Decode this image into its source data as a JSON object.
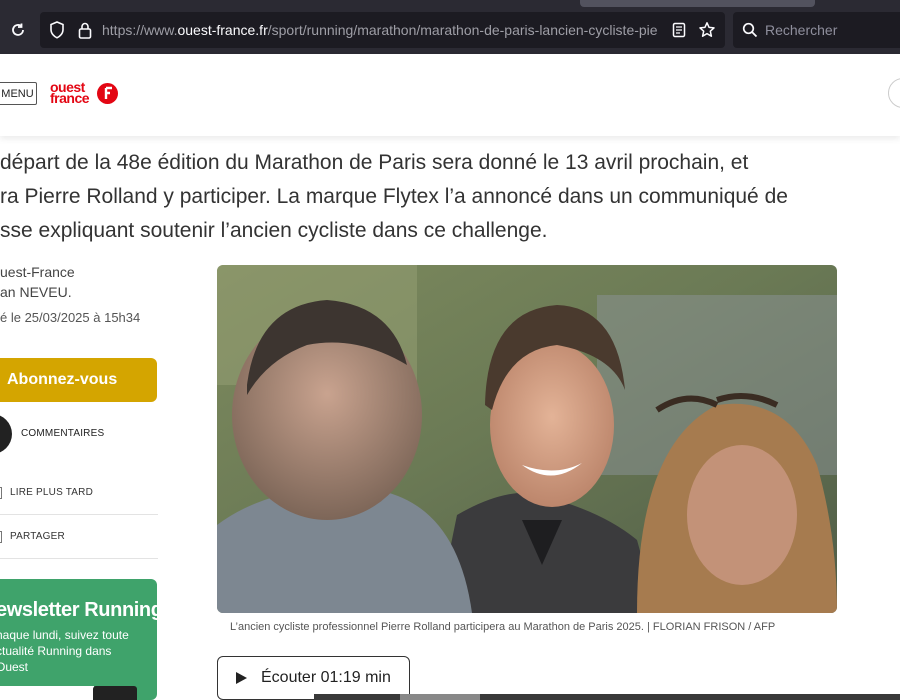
{
  "browser": {
    "url_prefix": "https://www.",
    "url_host": "ouest-france.fr",
    "url_path": "/sport/running/marathon/marathon-de-paris-lancien-cycliste-pie",
    "search_placeholder": "Rechercher"
  },
  "header": {
    "menu_label": "MENU",
    "logo_line1": "ouest",
    "logo_line2": "france"
  },
  "article": {
    "lead_lines": [
      "départ de la 48e édition du Marathon de Paris sera donné le 13 avril prochain, et",
      "ra Pierre Rolland y participer. La marque Flytex l’a annoncé dans un communiqué de",
      "sse expliquant soutenir l’ancien cycliste dans ce challenge."
    ],
    "source": "uest-France",
    "author": "an NEVEU.",
    "published": "é le 25/03/2025 à 15h34",
    "photo_caption": "L’ancien cycliste professionnel Pierre Rolland participera au Marathon de Paris 2025. | FLORIAN FRISON / AFP",
    "listen_label": "Écouter 01:19 min"
  },
  "sidebar": {
    "subscribe_label": "Abonnez-vous",
    "comments_label": "COMMENTAIRES",
    "read_later_label": "LIRE PLUS TARD",
    "share_label": "PARTAGER"
  },
  "newsletter": {
    "title": "ewsletter Running",
    "desc_lines": [
      "haque lundi, suivez toute",
      "ctualité Running dans",
      "Ouest"
    ]
  },
  "colors": {
    "brand_red": "#e30613",
    "subscribe": "#d4a500",
    "newsletter": "#3fa36b"
  }
}
